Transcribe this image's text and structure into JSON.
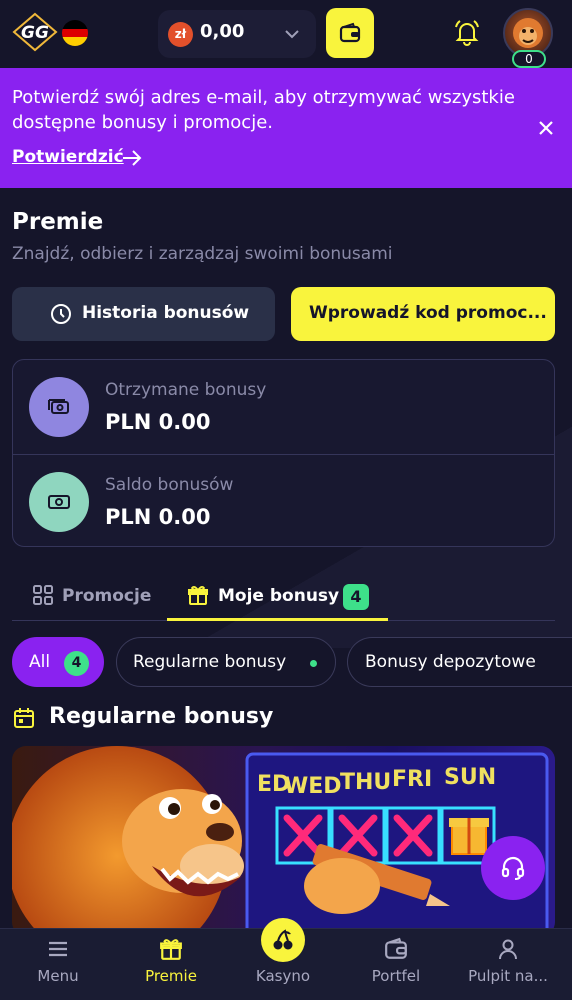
{
  "header": {
    "logo_text": "GG",
    "flag": "germany-flag",
    "currency_symbol": "zł",
    "balance": "0,00",
    "level": "0"
  },
  "banner": {
    "text": "Potwierdź swój adres e-mail, aby otrzymywać wszystkie dostępne bonusy i promocje.",
    "link_label": "Potwierdzić"
  },
  "page": {
    "title": "Premie",
    "subtitle": "Znajdź, odbierz i zarządzaj swoimi bonusami"
  },
  "actions": {
    "history_label": "Historia bonusów",
    "promo_label": "Wprowadź kod promoc..."
  },
  "stats": [
    {
      "label": "Otrzymane bonusy",
      "value": "PLN 0.00",
      "color": "#8f86e0"
    },
    {
      "label": "Saldo bonusów",
      "value": "PLN 0.00",
      "color": "#8fd6bf"
    }
  ],
  "tabs": [
    {
      "label": "Promocje",
      "active": false
    },
    {
      "label": "Moje bonusy",
      "active": true,
      "badge": "4"
    }
  ],
  "filters": [
    {
      "label": "All",
      "badge": "4",
      "active": true
    },
    {
      "label": "Regularne bonusy",
      "dot": true
    },
    {
      "label": "Bonusy depozytowe"
    }
  ],
  "section": {
    "title": "Regularne bonusy",
    "image_days": [
      "ED",
      "WED",
      "THU",
      "FRI",
      "SUN"
    ]
  },
  "bottom_nav": [
    {
      "label": "Menu",
      "icon": "menu-icon"
    },
    {
      "label": "Premie",
      "icon": "gift-icon",
      "active": true
    },
    {
      "label": "Kasyno",
      "icon": "cherry-icon"
    },
    {
      "label": "Portfel",
      "icon": "wallet-icon"
    },
    {
      "label": "Pulpit na...",
      "icon": "user-icon"
    }
  ],
  "colors": {
    "accent_yellow": "#f9f43d",
    "accent_purple": "#8a22f0",
    "accent_green": "#3ee08a",
    "background": "#15152a"
  }
}
